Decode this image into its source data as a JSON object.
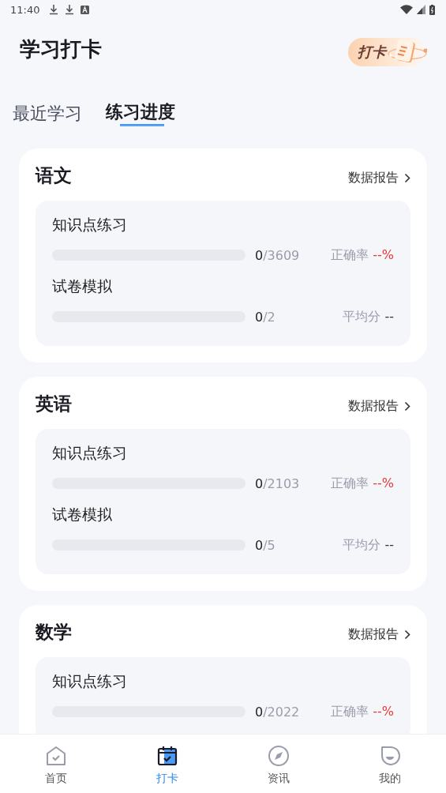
{
  "status_bar": {
    "time": "11:40"
  },
  "header": {
    "title": "学习打卡",
    "badge": "打卡"
  },
  "tabs": [
    {
      "label": "最近学习",
      "selected": false
    },
    {
      "label": "练习进度",
      "selected": true
    }
  ],
  "subjects": [
    {
      "name": "语文",
      "report_link": "数据报告",
      "rows": [
        {
          "kind": "accuracy",
          "label": "知识点练习",
          "level": 0,
          "done": "0",
          "total": "/3609",
          "stat_label": "正确率",
          "stat_value": "--%"
        },
        {
          "kind": "average",
          "label": "试卷模拟",
          "level": 0,
          "done": "0",
          "total": "/2",
          "stat_label": "平均分",
          "stat_value": "--"
        }
      ]
    },
    {
      "name": "英语",
      "report_link": "数据报告",
      "rows": [
        {
          "kind": "accuracy",
          "label": "知识点练习",
          "level": 0,
          "done": "0",
          "total": "/2103",
          "stat_label": "正确率",
          "stat_value": "--%"
        },
        {
          "kind": "average",
          "label": "试卷模拟",
          "level": 0,
          "done": "0",
          "total": "/5",
          "stat_label": "平均分",
          "stat_value": "--"
        }
      ]
    },
    {
      "name": "数学",
      "report_link": "数据报告",
      "rows": [
        {
          "kind": "accuracy",
          "label": "知识点练习",
          "level": 0,
          "done": "0",
          "total": "/2022",
          "stat_label": "正确率",
          "stat_value": "--%"
        }
      ]
    }
  ],
  "bottom_nav": [
    {
      "kind": "home",
      "label": "首页",
      "selected": false
    },
    {
      "kind": "calendar",
      "label": "打卡",
      "selected": true
    },
    {
      "kind": "compass",
      "label": "资讯",
      "selected": false
    },
    {
      "kind": "profile",
      "label": "我的",
      "selected": false
    }
  ]
}
